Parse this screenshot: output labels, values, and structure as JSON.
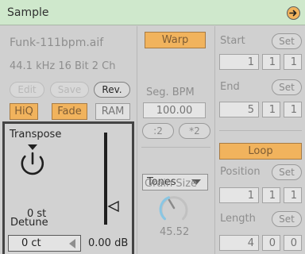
{
  "header": {
    "title": "Sample"
  },
  "sample": {
    "filename": "Funk-111bpm.aif",
    "format": "44.1 kHz 16 Bit 2 Ch",
    "edit_label": "Edit",
    "save_label": "Save",
    "rev_label": "Rev.",
    "hiq_label": "HiQ",
    "fade_label": "Fade",
    "ram_label": "RAM"
  },
  "transpose": {
    "label": "Transpose",
    "value": "0 st",
    "detune_label": "Detune",
    "detune_value": "0 ct",
    "gain_value": "0.00 dB"
  },
  "warp": {
    "warp_label": "Warp",
    "seg_bpm_label": "Seg. BPM",
    "seg_bpm_value": "100.00",
    "half_label": ":2",
    "double_label": "*2",
    "mode_value": "Tones",
    "grain_size_label": "Grain Size",
    "grain_size_value": "45.52"
  },
  "markers": {
    "start_label": "Start",
    "start_set": "Set",
    "start": [
      "1",
      "1",
      "1"
    ],
    "end_label": "End",
    "end_set": "Set",
    "end": [
      "5",
      "1",
      "1"
    ],
    "loop_label": "Loop",
    "position_label": "Position",
    "position_set": "Set",
    "position": [
      "1",
      "1",
      "1"
    ],
    "length_label": "Length",
    "length_set": "Set",
    "length": [
      "4",
      "0",
      "0"
    ]
  },
  "colors": {
    "title_bar": "#cfe8cc",
    "accent_orange": "#f1b35d",
    "panel_bg": "#d0d0d0",
    "grain_knob_arc": "#89c6e3"
  }
}
